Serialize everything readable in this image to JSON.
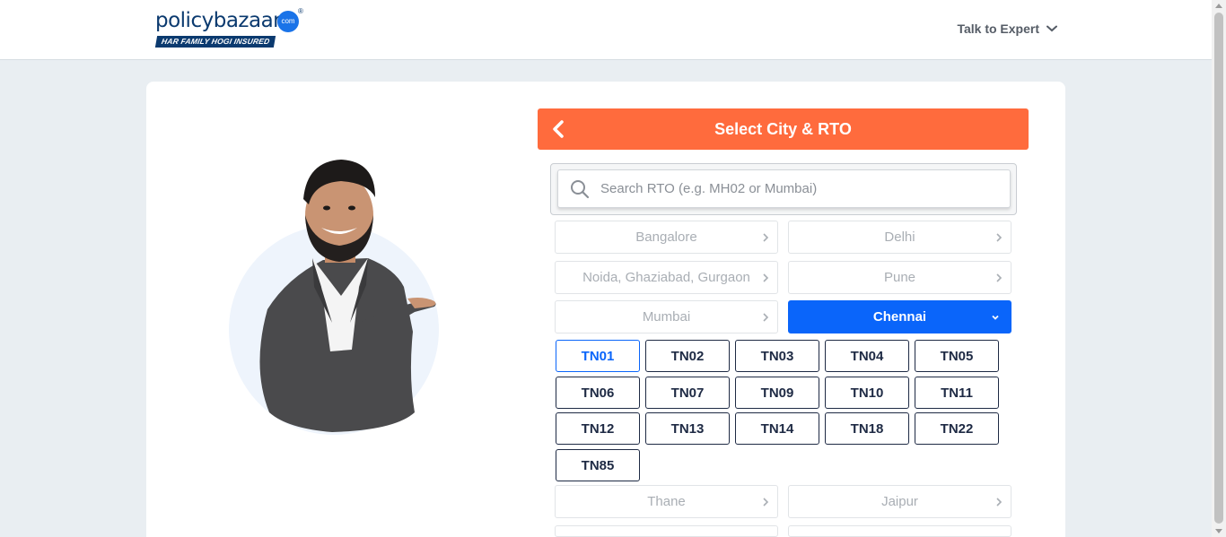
{
  "header": {
    "logo_text_1": "policy",
    "logo_text_2": "bazaar",
    "logo_dot": "com",
    "logo_reg": "®",
    "logo_tagline": "HAR FAMILY HOGI INSURED",
    "talk_label": "Talk to Expert"
  },
  "panel": {
    "title": "Select City & RTO",
    "search_placeholder": "Search RTO (e.g. MH02 or Mumbai)"
  },
  "cities_top": [
    {
      "label": "Bangalore"
    },
    {
      "label": "Delhi"
    },
    {
      "label": "Noida, Ghaziabad, Gurgaon"
    },
    {
      "label": "Pune"
    },
    {
      "label": "Mumbai"
    },
    {
      "label": "Chennai",
      "active": true
    }
  ],
  "rtos": [
    "TN01",
    "TN02",
    "TN03",
    "TN04",
    "TN05",
    "TN06",
    "TN07",
    "TN09",
    "TN10",
    "TN11",
    "TN12",
    "TN13",
    "TN14",
    "TN18",
    "TN22",
    "TN85"
  ],
  "selected_rto": "TN01",
  "cities_bottom": [
    {
      "label": "Thane"
    },
    {
      "label": "Jaipur"
    }
  ],
  "colors": {
    "accent_orange": "#ff6b3d",
    "active_blue": "#0a65fa",
    "navy": "#1e2a44"
  }
}
